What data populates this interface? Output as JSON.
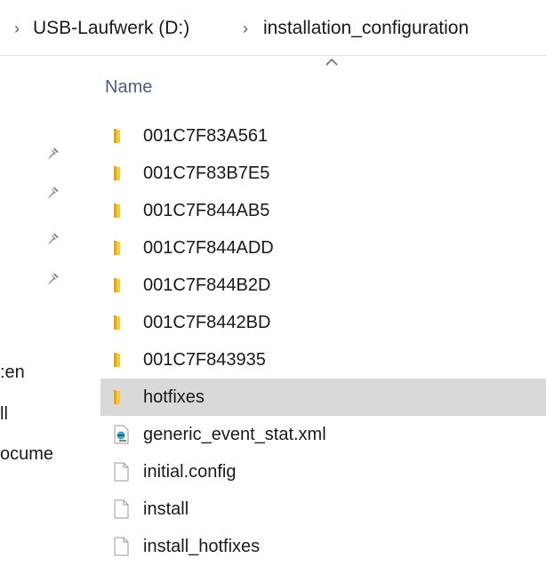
{
  "breadcrumb": {
    "leading_separator": "›",
    "items": [
      {
        "label": "USB-Laufwerk (D:)"
      },
      {
        "label": "installation_configuration"
      }
    ],
    "separator": "›"
  },
  "column_header": {
    "name_label": "Name",
    "sort_icon": "chevron-up-icon"
  },
  "nav_pane": {
    "pins": [
      "pin-icon",
      "pin-icon",
      "pin-icon",
      "pin-icon"
    ],
    "items": [
      {
        "label": ":en"
      },
      {
        "label": "ll"
      },
      {
        "label": "ocume"
      }
    ]
  },
  "files": [
    {
      "name": "001C7F83A561",
      "type": "folder"
    },
    {
      "name": "001C7F83B7E5",
      "type": "folder"
    },
    {
      "name": "001C7F844AB5",
      "type": "folder"
    },
    {
      "name": "001C7F844ADD",
      "type": "folder"
    },
    {
      "name": "001C7F844B2D",
      "type": "folder"
    },
    {
      "name": "001C7F8442BD",
      "type": "folder"
    },
    {
      "name": "001C7F843935",
      "type": "folder"
    },
    {
      "name": "hotfixes",
      "type": "folder",
      "selected": true
    },
    {
      "name": "generic_event_stat.xml",
      "type": "xml"
    },
    {
      "name": "initial.config",
      "type": "file"
    },
    {
      "name": "install",
      "type": "file"
    },
    {
      "name": "install_hotfixes",
      "type": "file"
    }
  ],
  "colors": {
    "folder": "#f2c94c",
    "folder_dark": "#dca62b",
    "selected_row": "#d9d9d9",
    "header_text": "#4d6082"
  }
}
